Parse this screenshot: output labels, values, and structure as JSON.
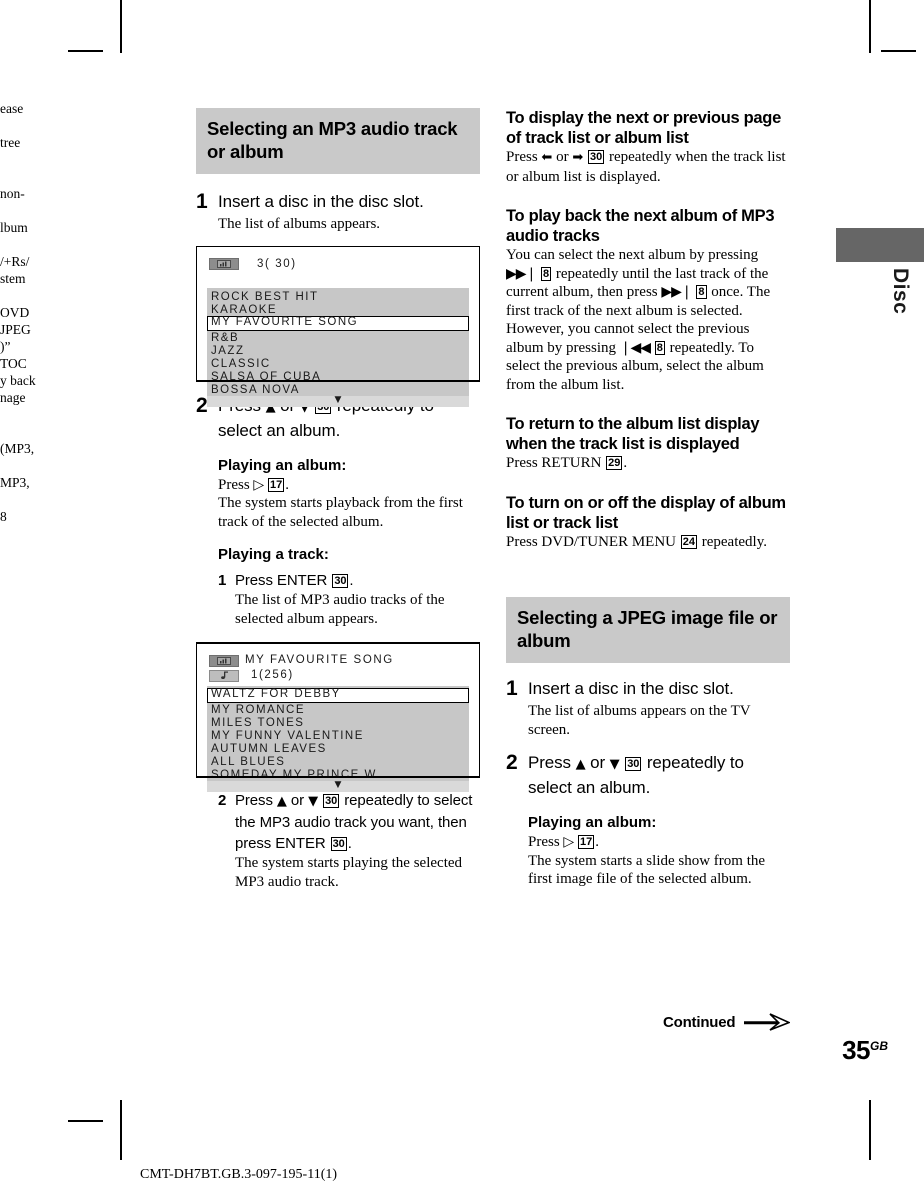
{
  "page": {
    "number": "35",
    "region_suffix": "GB",
    "continued_label": "Continued",
    "model_code": "CMT-DH7BT.GB.3-097-195-11(1)",
    "side_tab_label": "Disc"
  },
  "bleed_column": {
    "lines": [
      "ease",
      "",
      "tree",
      "",
      "",
      "non-",
      "",
      "lbum",
      "",
      "/+Rs/",
      "stem",
      "",
      "OVD",
      " JPEG",
      ")”",
      " TOC",
      "y back",
      "nage",
      "",
      "",
      "(MP3,",
      "",
      "MP3,",
      "",
      "8"
    ]
  },
  "mp3_section": {
    "header": "Selecting an MP3 audio track or album",
    "step1": {
      "number": "1",
      "title": "Insert a disc in the disc slot.",
      "desc": "The list of albums appears."
    },
    "album_screen": {
      "icon_name": "album-icon",
      "count": "3( 30)",
      "rows": [
        "ROCK BEST HIT",
        "KARAOKE",
        "MY FAVOURITE SONG",
        "R&B",
        "JAZZ",
        "CLASSIC",
        "SALSA OF CUBA",
        "BOSSA NOVA"
      ],
      "selected_index": 2,
      "scroll_glyph": "▼"
    },
    "step2": {
      "number": "2",
      "title_pre": "Press ",
      "arrow_up": "♦",
      "title_mid": " or ",
      "arrow_down": "♦",
      "keyref": "30",
      "title_post": " repeatedly to select an album."
    },
    "playing_album": {
      "label": "Playing an album:",
      "press_pre": "Press ",
      "play_glyph": "▷",
      "keyref": "17",
      "press_post": ".",
      "desc": "The system starts playback from the first track of the selected album."
    },
    "playing_track": {
      "label": "Playing a track:",
      "sub1": {
        "number": "1",
        "title_pre": "Press ENTER ",
        "keyref": "30",
        "title_post": ".",
        "desc": "The list of MP3 audio tracks of the selected album appears."
      },
      "sub2": {
        "number": "2",
        "title_pre": "Press ",
        "title_mid": " or ",
        "keyref": "30",
        "title_mid2": " repeatedly to select the MP3 audio track you want, then press ENTER ",
        "keyref2": "30",
        "title_post": ".",
        "desc": "The system starts playing the selected MP3 audio track."
      }
    },
    "track_screen": {
      "album_icon_name": "album-icon",
      "note_icon_name": "music-note-icon",
      "album_title": "MY FAVOURITE SONG",
      "count": "1(256)",
      "rows": [
        "WALTZ FOR DEBBY",
        "MY ROMANCE",
        "MILES TONES",
        "MY FUNNY VALENTINE",
        "AUTUMN LEAVES",
        "ALL BLUES",
        "SOMEDAY MY PRINCE W..."
      ],
      "selected_index": 0,
      "scroll_glyph": "▼"
    }
  },
  "right_column": {
    "page_nav": {
      "heading": "To display the next or previous page of track list or album list",
      "body_pre": "Press ",
      "arrow_left": "⬅",
      "body_mid": " or ",
      "arrow_right": "➡",
      "keyref": "30",
      "body_post": " repeatedly when the track list or album list is displayed."
    },
    "next_album": {
      "heading": "To play back the next album of MP3 audio tracks",
      "p1": "You can select the next album by pressing ",
      "next_glyph": "▶▶❘",
      "keyref1": "8",
      "p2": " repeatedly until the last track of the current album, then press ",
      "next_glyph2": "▶▶❘",
      "keyref2": "8",
      "p3": " once. The first track of the next album is selected. However, you cannot select the previous album by pressing ",
      "prev_glyph": "❘◀◀",
      "keyref3": "8",
      "p4": " repeatedly. To select the previous album, select the album from the album list."
    },
    "return_album": {
      "heading": "To return to the album list display when the track list is displayed",
      "body_pre": "Press RETURN ",
      "keyref": "29",
      "body_post": "."
    },
    "toggle_display": {
      "heading": "To turn on or off the display of album list or track list",
      "body_pre": "Press DVD/TUNER MENU ",
      "keyref": "24",
      "body_post": " repeatedly."
    },
    "jpeg_section": {
      "header": "Selecting a JPEG image file or album",
      "step1": {
        "number": "1",
        "title": "Insert a disc in the disc slot.",
        "desc": "The list of albums appears on the TV screen."
      },
      "step2": {
        "number": "2",
        "title_pre": "Press ",
        "title_mid": " or ",
        "keyref": "30",
        "title_post": " repeatedly to select an album."
      },
      "playing_album": {
        "label": "Playing an album:",
        "press_pre": "Press ",
        "play_glyph": "▷",
        "keyref": "17",
        "press_post": ".",
        "desc": "The system starts a slide show from the first image file of the selected album."
      }
    }
  }
}
